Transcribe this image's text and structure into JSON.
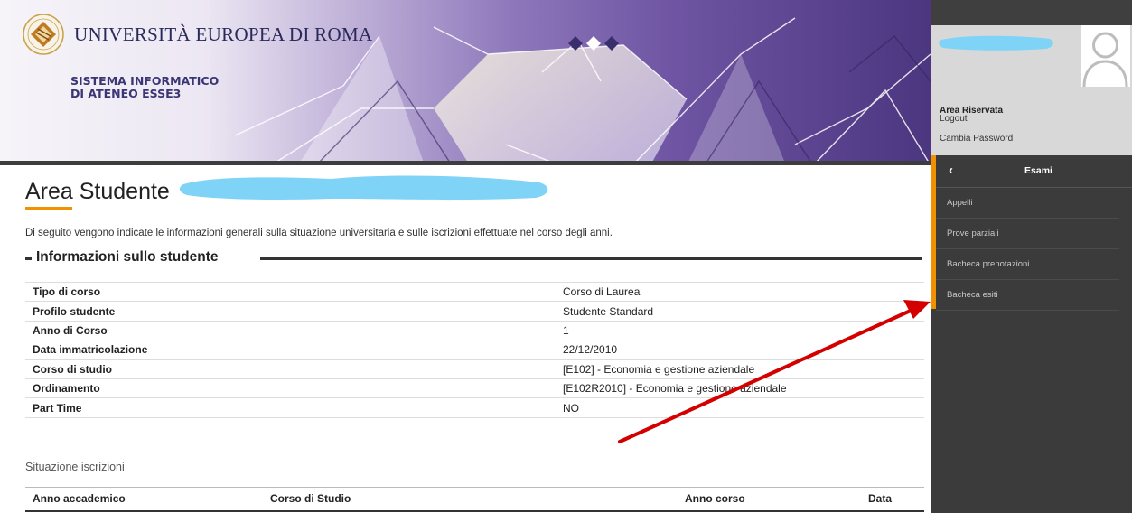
{
  "header": {
    "university_name": "UNIVERSITÀ EUROPEA DI ROMA",
    "system_title_line1": "SISTEMA INFORMATICO",
    "system_title_line2": "DI ATENEO ESSE3"
  },
  "page": {
    "title": "Area Studente",
    "intro": "Di seguito vengono indicate le informazioni generali sulla situazione universitaria e sulle iscrizioni effettuate nel corso degli anni."
  },
  "student_info": {
    "heading": "Informazioni sullo studente",
    "rows": [
      {
        "label": "Tipo di corso",
        "value": "Corso di Laurea"
      },
      {
        "label": "Profilo studente",
        "value": "Studente Standard"
      },
      {
        "label": "Anno di Corso",
        "value": "1"
      },
      {
        "label": "Data immatricolazione",
        "value": "22/12/2010"
      },
      {
        "label": "Corso di studio",
        "value": "[E102] - Economia e gestione aziendale"
      },
      {
        "label": "Ordinamento",
        "value": "[E102R2010] - Economia e gestione aziendale"
      },
      {
        "label": "Part Time",
        "value": "NO"
      }
    ]
  },
  "enrollments": {
    "title": "Situazione iscrizioni",
    "columns": [
      "Anno accademico",
      "Corso di Studio",
      "Anno corso",
      "Data"
    ]
  },
  "side_panel": {
    "area_label": "Area Riservata",
    "logout_label": "Logout",
    "change_password_label": "Cambia Password",
    "menu_title": "Esami",
    "back_glyph": "‹",
    "menu_items": [
      "Appelli",
      "Prove parziali",
      "Bacheca prenotazioni",
      "Bacheca esiti"
    ]
  },
  "colors": {
    "accent": "#f29100",
    "panel_dark": "#3b3b3b",
    "annotation_arrow": "#d40000",
    "redaction": "#7fd3f7"
  }
}
